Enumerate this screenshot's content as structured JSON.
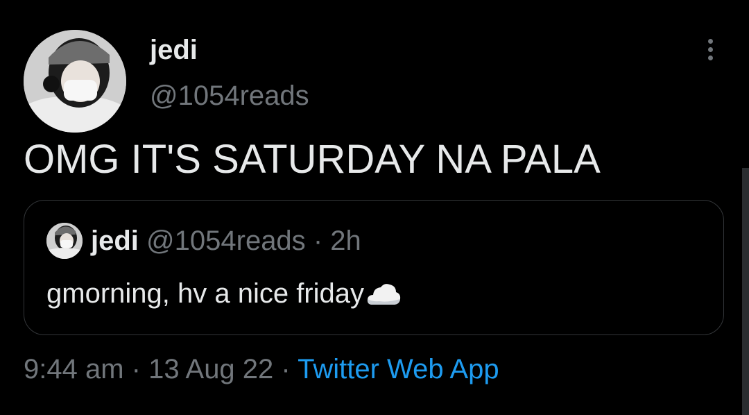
{
  "tweet": {
    "author": {
      "display_name": "jedi",
      "handle": "@1054reads"
    },
    "text": "OMG IT'S SATURDAY NA PALA",
    "quoted": {
      "display_name": "jedi",
      "handle": "@1054reads",
      "separator": "·",
      "age": "2h",
      "text": "gmorning, hv a nice friday",
      "emoji_icon": "cloud-icon"
    },
    "meta": {
      "time": "9:44 am",
      "separator": "·",
      "date": "13 Aug 22",
      "source": "Twitter Web App"
    }
  },
  "colors": {
    "background": "#000000",
    "primary_text": "#e7e9ea",
    "secondary_text": "#71767b",
    "link": "#1d9bf0",
    "border": "#333639"
  }
}
